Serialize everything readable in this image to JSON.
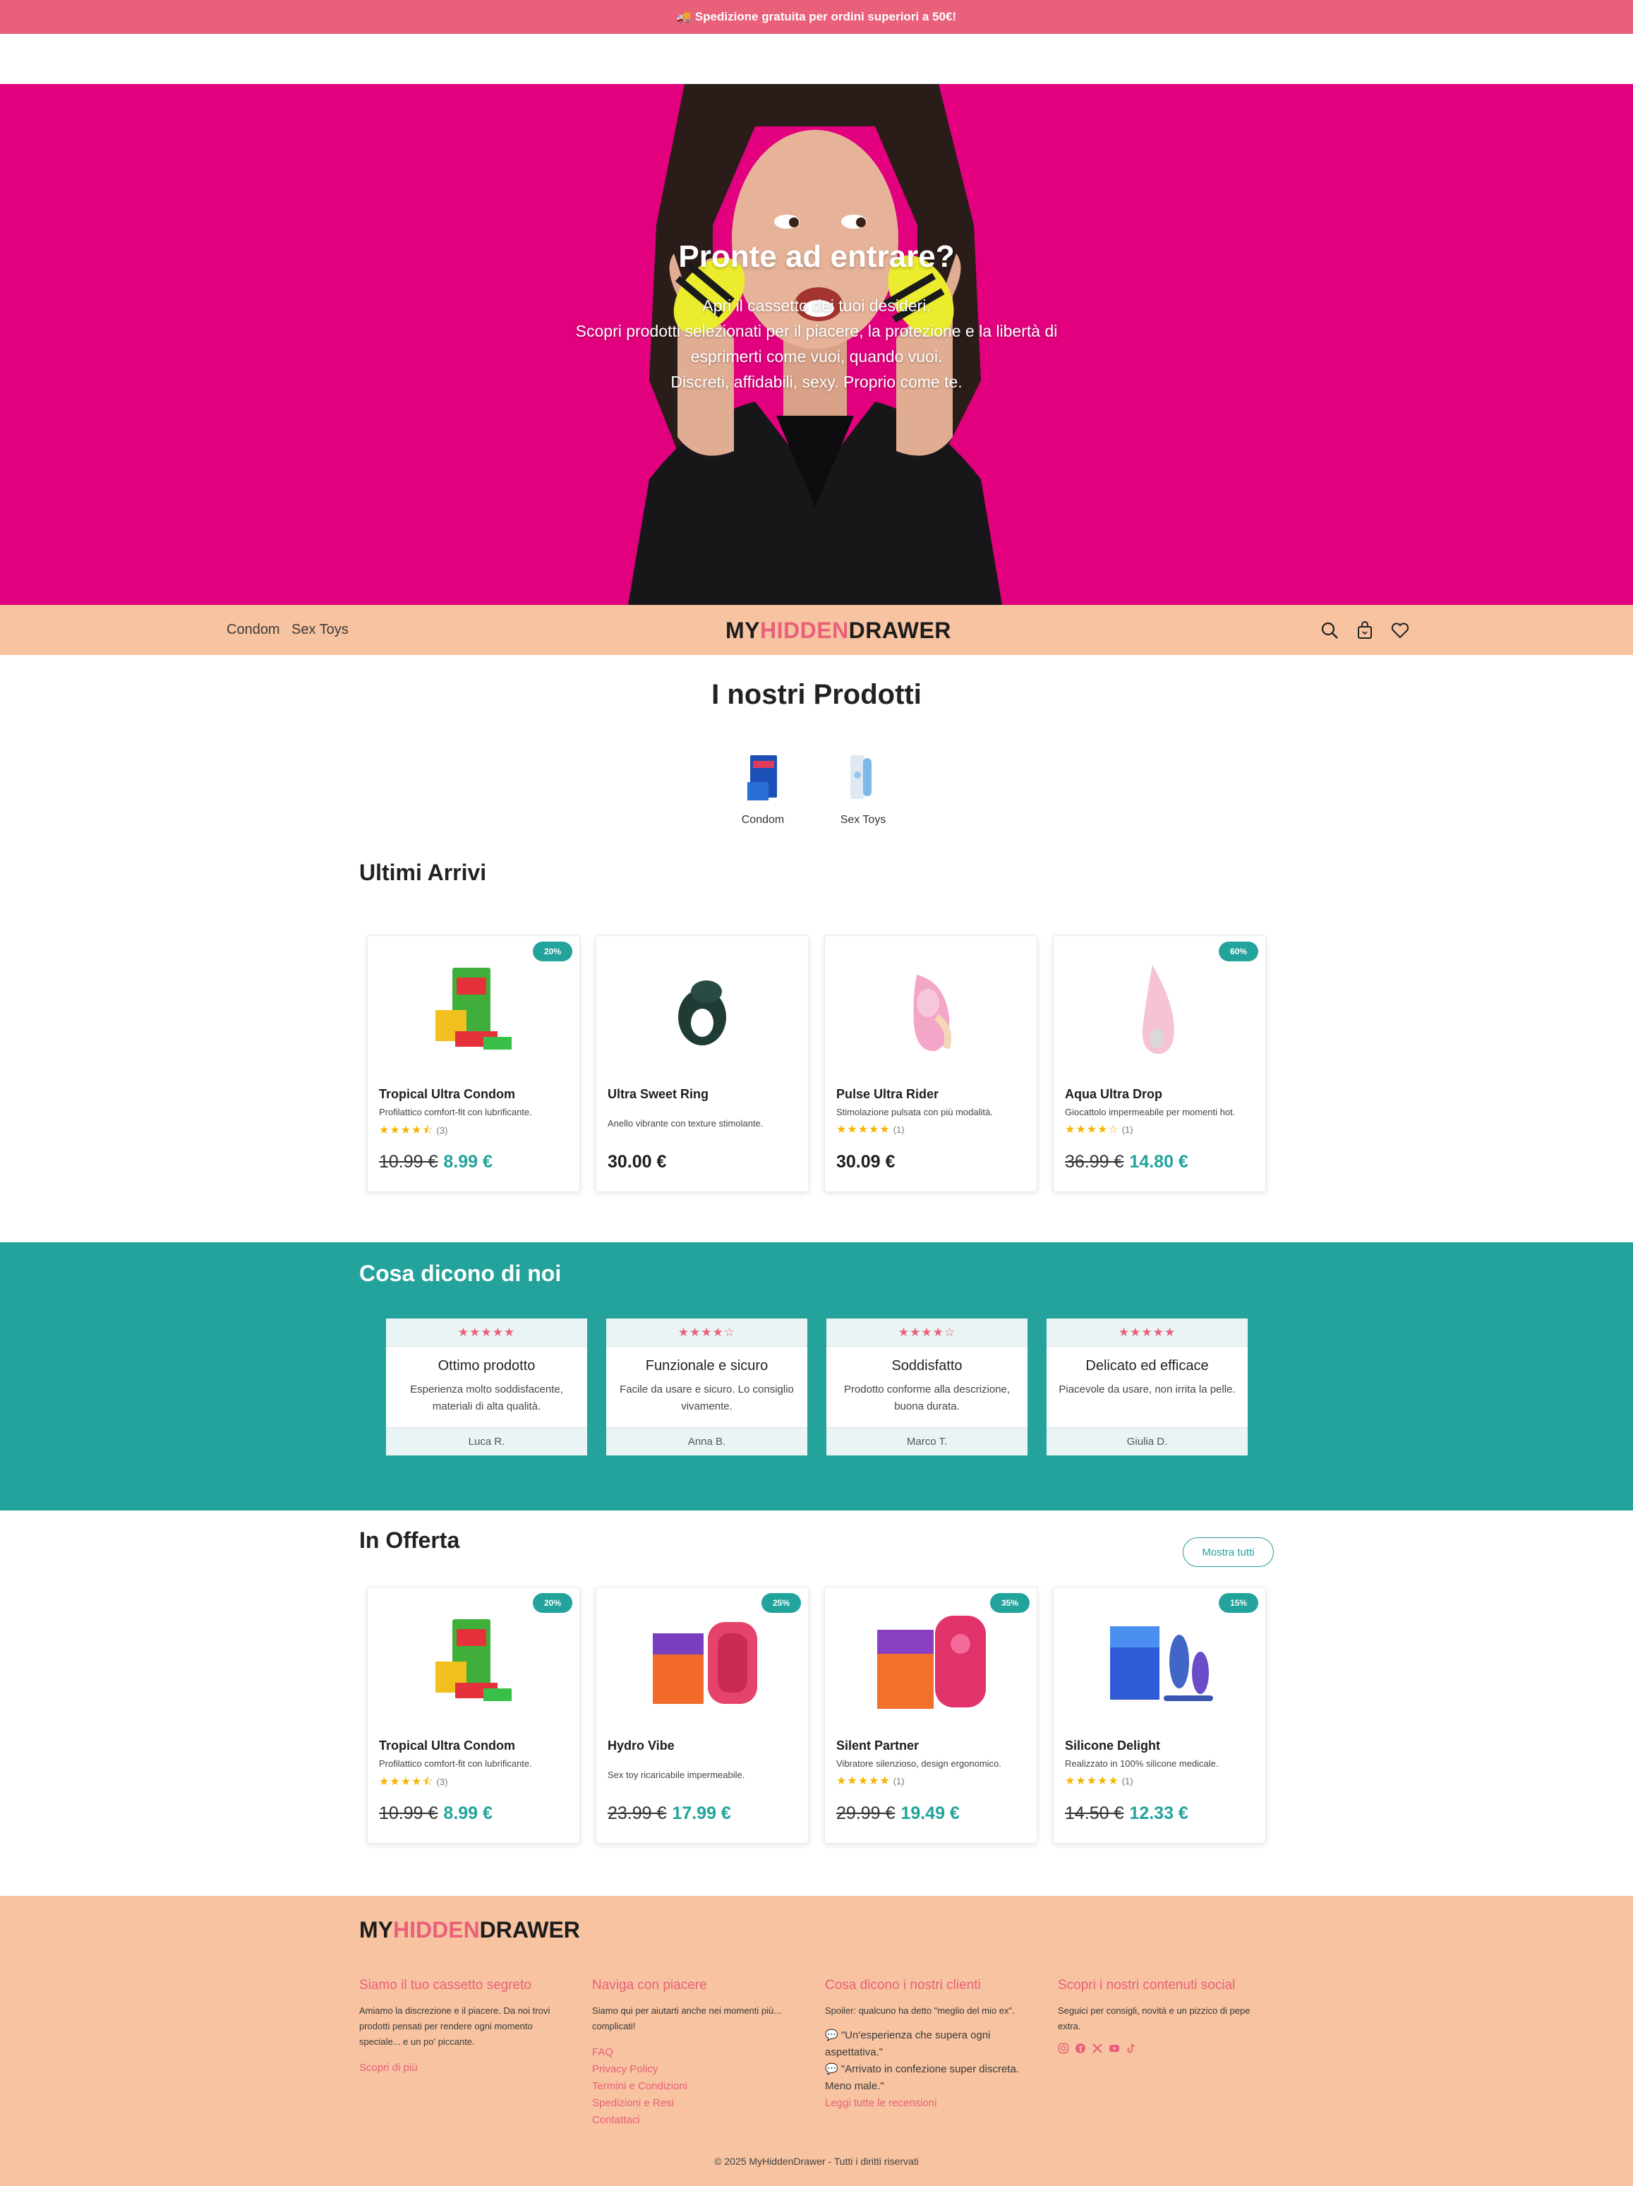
{
  "announcement": {
    "icon": "truck-icon",
    "text": "🚚 Spedizione gratuita per ordini superiori a 50€!"
  },
  "hero": {
    "title": "Pronte ad entrare?",
    "lines": [
      "Apri il cassetto dei tuoi desideri.",
      "Scopri prodotti selezionati per il piacere, la protezione e la libertà di",
      "esprimerti come vuoi, quando vuoi.",
      "Discreti, affidabili, sexy. Proprio come te."
    ],
    "background": "#e2007e"
  },
  "nav": {
    "links": [
      "Condom",
      "Sex Toys"
    ],
    "logo": {
      "part1": "MY",
      "part2": "HIDDEN",
      "part3": "DRAWER"
    },
    "icons": [
      "search-icon",
      "bag-icon",
      "heart-icon"
    ]
  },
  "products_section": {
    "title": "I nostri Prodotti",
    "categories": [
      "Condom",
      "Sex Toys"
    ]
  },
  "latest": {
    "title": "Ultimi Arrivi",
    "items": [
      {
        "badge": "20%",
        "name": "Tropical Ultra Condom",
        "desc": "Profilattico comfort-fit con lubrificante.",
        "stars": "★★★★⯪",
        "count": "(3)",
        "old_price": "10.99 €",
        "price": "8.99 €"
      },
      {
        "badge": "",
        "name": "Ultra Sweet Ring",
        "desc": "Anello vibrante con texture stimolante.",
        "stars": "",
        "count": "",
        "old_price": "",
        "price": "30.00 €"
      },
      {
        "badge": "",
        "name": "Pulse Ultra Rider",
        "desc": "Stimolazione pulsata con più modalità.",
        "stars": "★★★★★",
        "count": "(1)",
        "old_price": "",
        "price": "30.09 €"
      },
      {
        "badge": "60%",
        "name": "Aqua Ultra Drop",
        "desc": "Giocattolo impermeabile per momenti hot.",
        "stars": "★★★★☆",
        "count": "(1)",
        "old_price": "36.99 €",
        "price": "14.80 €"
      }
    ]
  },
  "testimonials": {
    "title": "Cosa dicono di noi",
    "items": [
      {
        "stars": "★★★★★",
        "title": "Ottimo prodotto",
        "body": "Esperienza molto soddisfacente, materiali di alta qualità.",
        "author": "Luca R."
      },
      {
        "stars": "★★★★☆",
        "title": "Funzionale e sicuro",
        "body": "Facile da usare e sicuro. Lo consiglio vivamente.",
        "author": "Anna B."
      },
      {
        "stars": "★★★★☆",
        "title": "Soddisfatto",
        "body": "Prodotto conforme alla descrizione, buona durata.",
        "author": "Marco T."
      },
      {
        "stars": "★★★★★",
        "title": "Delicato ed efficace",
        "body": "Piacevole da usare, non irrita la pelle.",
        "author": "Giulia D."
      }
    ]
  },
  "offers": {
    "title": "In Offerta",
    "show_all": "Mostra tutti",
    "items": [
      {
        "badge": "20%",
        "name": "Tropical Ultra Condom",
        "desc": "Profilattico comfort-fit con lubrificante.",
        "stars": "★★★★⯪",
        "count": "(3)",
        "old_price": "10.99 €",
        "price": "8.99 €"
      },
      {
        "badge": "25%",
        "name": "Hydro Vibe",
        "desc": "Sex toy ricaricabile impermeabile.",
        "stars": "",
        "count": "",
        "old_price": "23.99 €",
        "price": "17.99 €"
      },
      {
        "badge": "35%",
        "name": "Silent Partner",
        "desc": "Vibratore silenzioso, design ergonomico.",
        "stars": "★★★★★",
        "count": "(1)",
        "old_price": "29.99 €",
        "price": "19.49 €"
      },
      {
        "badge": "15%",
        "name": "Silicone Delight",
        "desc": "Realizzato in 100% silicone medicale.",
        "stars": "★★★★★",
        "count": "(1)",
        "old_price": "14.50 €",
        "price": "12.33 €"
      }
    ]
  },
  "footer": {
    "col1": {
      "title": "Siamo il tuo cassetto segreto",
      "lines": [
        "Amiamo la discrezione e il piacere. Da noi trovi",
        "prodotti pensati per rendere ogni momento",
        "speciale... e un po' piccante."
      ],
      "link": "Scopri di più"
    },
    "col2": {
      "title": "Naviga con piacere",
      "lines": [
        "Siamo qui per aiutarti anche nei momenti più...",
        "complicati!"
      ],
      "links": [
        "FAQ",
        "Privacy Policy",
        "Termini e Condizioni",
        "Spedizioni e Resi",
        "Contattaci"
      ]
    },
    "col3": {
      "title": "Cosa dicono i nostri clienti",
      "intro": "Spoiler: qualcuno ha detto \"meglio del mio ex\".",
      "quote1a": "💬 \"Un'esperienza che supera ogni",
      "quote1b": "aspettativa.\"",
      "quote2a": "💬 \"Arrivato in confezione super discreta.",
      "quote2b": "Meno male.\"",
      "link": "Leggi tutte le recensioni"
    },
    "col4": {
      "title": "Scopri i nostri contenuti social",
      "lines": [
        "Seguici per consigli, novità e un pizzico di pepe",
        "extra."
      ],
      "icons": [
        "instagram-icon",
        "facebook-icon",
        "x-icon",
        "youtube-icon",
        "tiktok-icon"
      ]
    },
    "copyright": "© 2025 MyHiddenDrawer - Tutti i diritti riservati"
  },
  "colors": {
    "accent": "#22a39b",
    "pink": "#e8607a",
    "peach": "#f7c3a0",
    "magenta": "#e2007e"
  }
}
